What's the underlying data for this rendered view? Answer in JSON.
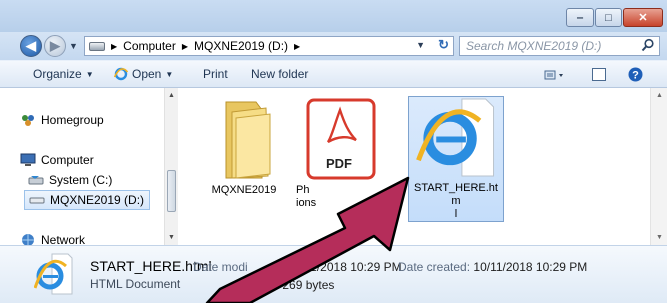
{
  "window": {
    "minimize_glyph": "‒",
    "maximize_glyph": "□",
    "close_glyph": "✕"
  },
  "address": {
    "crumbs": [
      "Computer",
      "MQXNE2019 (D:)"
    ],
    "separator": "▶",
    "search_placeholder": "Search MQXNE2019 (D:)"
  },
  "toolbar": {
    "organize": "Organize",
    "open": "Open",
    "print": "Print",
    "new_folder": "New folder"
  },
  "sidebar": {
    "items": [
      {
        "label": "Homegroup",
        "icon": "homegroup-icon"
      },
      {
        "label": "Computer",
        "icon": "computer-icon"
      },
      {
        "label": "System (C:)",
        "icon": "drive-icon"
      },
      {
        "label": "MQXNE2019 (D:)",
        "icon": "drive-icon",
        "selected": true
      },
      {
        "label": "Network",
        "icon": "network-icon"
      }
    ]
  },
  "files": [
    {
      "name": "MQXNE2019",
      "icon": "folder-icon"
    },
    {
      "name": "Ph\nions",
      "icon": "pdf-icon",
      "badge": "PDF"
    },
    {
      "name": "START_HERE.htm\nl",
      "icon": "ie-icon",
      "selected": true
    }
  ],
  "details": {
    "name": "START_HERE.html",
    "type": "HTML Document",
    "modified_label": "Date modi",
    "modified_value": "11/2018 10:29 PM",
    "size_value": "269 bytes",
    "created_label": "Date created:",
    "created_value": "10/11/2018 10:29 PM"
  },
  "colors": {
    "arrow_fill": "#b52d5a",
    "arrow_stroke": "#000000",
    "selection": "#cde3fb"
  }
}
